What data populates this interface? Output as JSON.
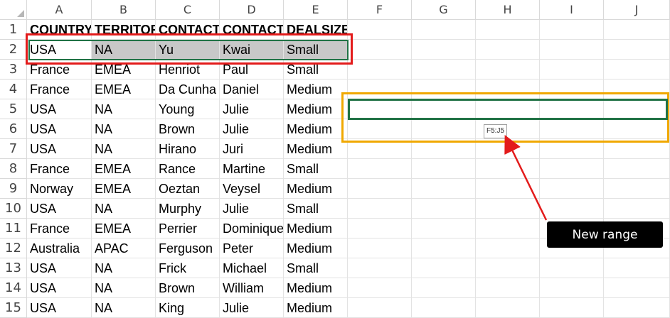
{
  "columns": [
    "A",
    "B",
    "C",
    "D",
    "E",
    "F",
    "G",
    "H",
    "I",
    "J"
  ],
  "rows": [
    {
      "num": "1",
      "cells": [
        "COUNTRY",
        "TERRITOR",
        "CONTACT",
        "CONTACT",
        "DEALSIZE"
      ]
    },
    {
      "num": "2",
      "cells": [
        "USA",
        "NA",
        "Yu",
        "Kwai",
        "Small"
      ]
    },
    {
      "num": "3",
      "cells": [
        "France",
        "EMEA",
        "Henriot",
        "Paul",
        "Small"
      ]
    },
    {
      "num": "4",
      "cells": [
        "France",
        "EMEA",
        "Da Cunha",
        "Daniel",
        "Medium"
      ]
    },
    {
      "num": "5",
      "cells": [
        "USA",
        "NA",
        "Young",
        "Julie",
        "Medium"
      ]
    },
    {
      "num": "6",
      "cells": [
        "USA",
        "NA",
        "Brown",
        "Julie",
        "Medium"
      ]
    },
    {
      "num": "7",
      "cells": [
        "USA",
        "NA",
        "Hirano",
        "Juri",
        "Medium"
      ]
    },
    {
      "num": "8",
      "cells": [
        "France",
        "EMEA",
        "Rance",
        "Martine",
        "Small"
      ]
    },
    {
      "num": "9",
      "cells": [
        "Norway",
        "EMEA",
        "Oeztan",
        "Veysel",
        "Medium"
      ]
    },
    {
      "num": "10",
      "cells": [
        "USA",
        "NA",
        "Murphy",
        "Julie",
        "Small"
      ]
    },
    {
      "num": "11",
      "cells": [
        "France",
        "EMEA",
        "Perrier",
        "Dominique",
        "Medium"
      ]
    },
    {
      "num": "12",
      "cells": [
        "Australia",
        "APAC",
        "Ferguson",
        "Peter",
        "Medium"
      ]
    },
    {
      "num": "13",
      "cells": [
        "USA",
        "NA",
        "Frick",
        "Michael",
        "Small"
      ]
    },
    {
      "num": "14",
      "cells": [
        "USA",
        "NA",
        "Brown",
        "William",
        "Medium"
      ]
    },
    {
      "num": "15",
      "cells": [
        "USA",
        "NA",
        "King",
        "Julie",
        "Medium"
      ]
    }
  ],
  "range_tooltip": "F5:J5",
  "callout_label": "New range",
  "colors": {
    "selection_green": "#217346",
    "annotation_red": "#e31b1b",
    "annotation_orange": "#f0a800",
    "shaded_cell": "#c8c8c8"
  }
}
